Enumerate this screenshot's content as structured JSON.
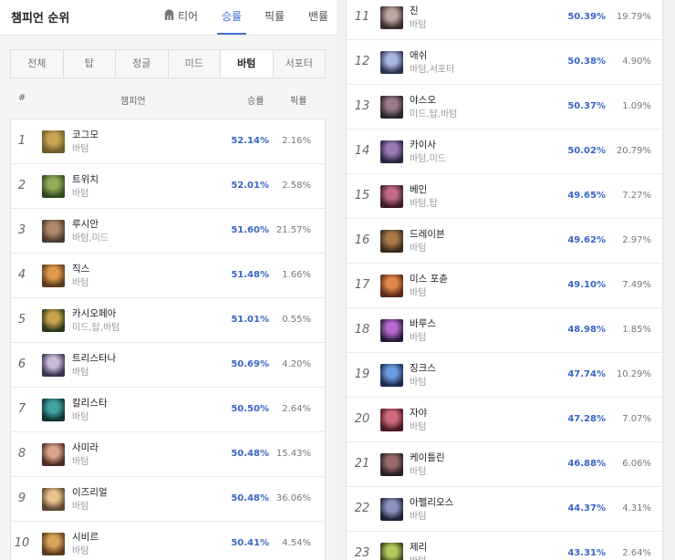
{
  "header": {
    "title": "챔피언 순위",
    "tabs": [
      {
        "label": "티어",
        "icon": "helmet-icon",
        "active": false
      },
      {
        "label": "승률",
        "active": true
      },
      {
        "label": "픽률",
        "active": false
      },
      {
        "label": "밴률",
        "active": false
      }
    ]
  },
  "positions": [
    {
      "label": "전체",
      "active": false
    },
    {
      "label": "탑",
      "active": false
    },
    {
      "label": "정글",
      "active": false
    },
    {
      "label": "미드",
      "active": false
    },
    {
      "label": "바텀",
      "active": true
    },
    {
      "label": "서포터",
      "active": false
    }
  ],
  "columns": {
    "rank": "#",
    "champion": "챔피언",
    "winrate": "승률",
    "pickrate": "픽률"
  },
  "colors": {
    "accent": "#4171d6",
    "winrate": "#3866c4"
  },
  "champions": [
    {
      "rank": "1",
      "name": "코그모",
      "positions": "바텀",
      "winrate": "52.14%",
      "pickrate": "2.16%",
      "icon": "kogmaw-portrait-icon",
      "c1": "#6b5a2a",
      "c2": "#c9a654"
    },
    {
      "rank": "2",
      "name": "트위치",
      "positions": "바텀",
      "winrate": "52.01%",
      "pickrate": "2.58%",
      "icon": "twitch-portrait-icon",
      "c1": "#2f4a22",
      "c2": "#8fae55"
    },
    {
      "rank": "3",
      "name": "루시안",
      "positions": "바텀,미드",
      "winrate": "51.60%",
      "pickrate": "21.57%",
      "icon": "lucian-portrait-icon",
      "c1": "#4a3a2e",
      "c2": "#b08a6a"
    },
    {
      "rank": "4",
      "name": "직스",
      "positions": "바텀",
      "winrate": "51.48%",
      "pickrate": "1.66%",
      "icon": "ziggs-portrait-icon",
      "c1": "#5b3b1f",
      "c2": "#e09b4a"
    },
    {
      "rank": "5",
      "name": "카시오페아",
      "positions": "미드,탑,바텀",
      "winrate": "51.01%",
      "pickrate": "0.55%",
      "icon": "cassiopeia-portrait-icon",
      "c1": "#2b3a1c",
      "c2": "#c8a34c"
    },
    {
      "rank": "6",
      "name": "트리스타나",
      "positions": "바텀",
      "winrate": "50.69%",
      "pickrate": "4.20%",
      "icon": "tristana-portrait-icon",
      "c1": "#3a3350",
      "c2": "#c8b9d6"
    },
    {
      "rank": "7",
      "name": "칼리스타",
      "positions": "바텀",
      "winrate": "50.50%",
      "pickrate": "2.64%",
      "icon": "kalista-portrait-icon",
      "c1": "#123234",
      "c2": "#3fa5a1"
    },
    {
      "rank": "8",
      "name": "사미라",
      "positions": "바텀",
      "winrate": "50.48%",
      "pickrate": "15.43%",
      "icon": "samira-portrait-icon",
      "c1": "#4a2a24",
      "c2": "#d9a48a"
    },
    {
      "rank": "9",
      "name": "이즈리얼",
      "positions": "바텀",
      "winrate": "50.48%",
      "pickrate": "36.06%",
      "icon": "ezreal-portrait-icon",
      "c1": "#5a4630",
      "c2": "#e6c48c"
    },
    {
      "rank": "10",
      "name": "시비르",
      "positions": "바텀",
      "winrate": "50.41%",
      "pickrate": "4.54%",
      "icon": "sivir-portrait-icon",
      "c1": "#5a3a1c",
      "c2": "#d9a45a"
    },
    {
      "rank": "11",
      "name": "진",
      "positions": "바텀",
      "winrate": "50.39%",
      "pickrate": "19.79%",
      "icon": "jhin-portrait-icon",
      "c1": "#3a2a2a",
      "c2": "#b9a8a0"
    },
    {
      "rank": "12",
      "name": "애쉬",
      "positions": "바텀,서포터",
      "winrate": "50.38%",
      "pickrate": "4.90%",
      "icon": "ashe-portrait-icon",
      "c1": "#2c3350",
      "c2": "#a9b6e0"
    },
    {
      "rank": "13",
      "name": "야스오",
      "positions": "미드,탑,바텀",
      "winrate": "50.37%",
      "pickrate": "1.09%",
      "icon": "yasuo-portrait-icon",
      "c1": "#2a2430",
      "c2": "#9a7a8a"
    },
    {
      "rank": "14",
      "name": "카이사",
      "positions": "바텀,미드",
      "winrate": "50.02%",
      "pickrate": "20.79%",
      "icon": "kaisa-portrait-icon",
      "c1": "#2a2240",
      "c2": "#9a7ab4"
    },
    {
      "rank": "15",
      "name": "베인",
      "positions": "바텀,탑",
      "winrate": "49.65%",
      "pickrate": "7.27%",
      "icon": "vayne-portrait-icon",
      "c1": "#3a1a28",
      "c2": "#c06a86"
    },
    {
      "rank": "16",
      "name": "드레이븐",
      "positions": "바텀",
      "winrate": "49.62%",
      "pickrate": "2.97%",
      "icon": "draven-portrait-icon",
      "c1": "#3a2a1a",
      "c2": "#a87a4a"
    },
    {
      "rank": "17",
      "name": "미스 포츈",
      "positions": "바텀",
      "winrate": "49.10%",
      "pickrate": "7.49%",
      "icon": "miss-fortune-portrait-icon",
      "c1": "#5a2a18",
      "c2": "#e0864a"
    },
    {
      "rank": "18",
      "name": "바루스",
      "positions": "바텀",
      "winrate": "48.98%",
      "pickrate": "1.85%",
      "icon": "varus-portrait-icon",
      "c1": "#2a1a3a",
      "c2": "#b46ad0"
    },
    {
      "rank": "19",
      "name": "징크스",
      "positions": "바텀",
      "winrate": "47.74%",
      "pickrate": "10.29%",
      "icon": "jinx-portrait-icon",
      "c1": "#1a2a4a",
      "c2": "#6a9ae0"
    },
    {
      "rank": "20",
      "name": "자야",
      "positions": "바텀",
      "winrate": "47.28%",
      "pickrate": "7.07%",
      "icon": "xayah-portrait-icon",
      "c1": "#4a1a22",
      "c2": "#d06a7a"
    },
    {
      "rank": "21",
      "name": "케이틀린",
      "positions": "바텀",
      "winrate": "46.88%",
      "pickrate": "6.06%",
      "icon": "caitlyn-portrait-icon",
      "c1": "#2a1e22",
      "c2": "#9a6a6a"
    },
    {
      "rank": "22",
      "name": "아펠리오스",
      "positions": "바텀",
      "winrate": "44.37%",
      "pickrate": "4.31%",
      "icon": "aphelios-portrait-icon",
      "c1": "#1e2436",
      "c2": "#8a94c0"
    },
    {
      "rank": "23",
      "name": "제리",
      "positions": "바텀",
      "winrate": "43.31%",
      "pickrate": "2.64%",
      "icon": "zeri-portrait-icon",
      "c1": "#2a3a1a",
      "c2": "#b4c85a"
    }
  ]
}
